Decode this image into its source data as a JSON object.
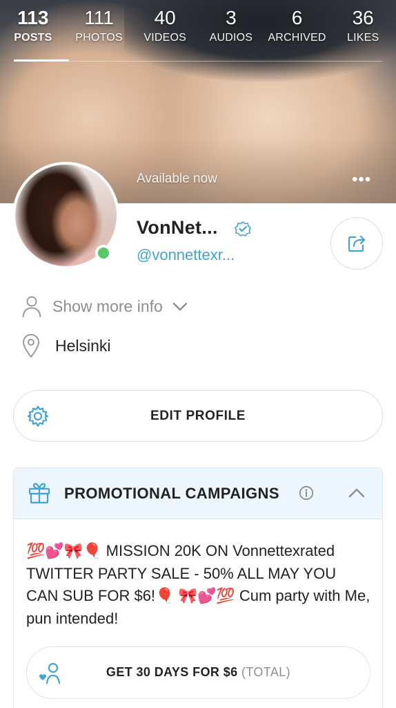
{
  "header": {
    "stats": [
      {
        "count": "113",
        "label": "POSTS"
      },
      {
        "count": "111",
        "label": "PHOTOS"
      },
      {
        "count": "40",
        "label": "VIDEOS"
      },
      {
        "count": "3",
        "label": "AUDIOS"
      },
      {
        "count": "6",
        "label": "ARCHIVED"
      },
      {
        "count": "36",
        "label": "LIKES"
      }
    ],
    "active_tab": "POSTS",
    "status_text": "Available now",
    "more_glyph": "•••"
  },
  "profile": {
    "display_name": "VonNet...",
    "username": "@vonnettexr...",
    "online": true,
    "verified": true
  },
  "info": {
    "show_more_label": "Show more info",
    "location": "Helsinki"
  },
  "edit_profile": {
    "label": "EDIT PROFILE"
  },
  "promo": {
    "title": "PROMOTIONAL CAMPAIGNS",
    "text": "💯💕🎀🎈 MISSION 20K ON Vonnettexrated TWITTER PARTY SALE - 50% ALL MAY YOU CAN SUB FOR $6!🎈 🎀💕💯 Cum party with Me, pun intended!",
    "button_label": "GET 30 DAYS FOR $6",
    "button_sub": "(TOTAL)"
  },
  "colors": {
    "accent": "#3fa3d5",
    "online": "#5ac86a",
    "promo_header_bg": "#edf6fc",
    "muted_text": "#8d8d8d"
  },
  "icons": {
    "verified": "check-badge-icon",
    "share": "share-icon",
    "person": "person-icon",
    "chevron": "chevron-down-icon",
    "location": "location-pin-icon",
    "gear": "gear-icon",
    "gift": "gift-icon",
    "info": "info-icon",
    "collapse": "chevron-up-icon",
    "subscribe": "subscribe-user-icon"
  }
}
